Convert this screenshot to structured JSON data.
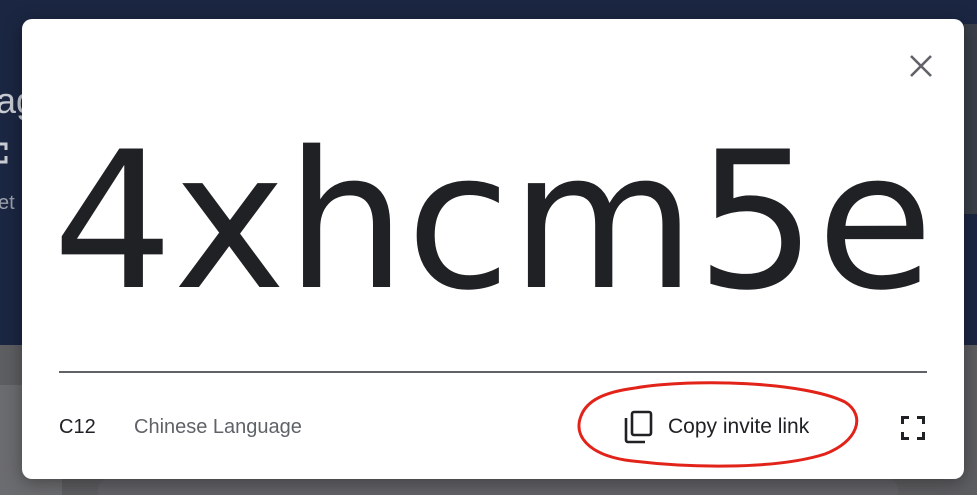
{
  "background": {
    "title_fragment": "ag",
    "subtitle_fragment": "et"
  },
  "modal": {
    "class_code": "4xhcm5e",
    "section": "C12",
    "class_name": "Chinese Language",
    "copy_link_label": "Copy invite link",
    "icons": {
      "close": "close-icon",
      "copy": "copy-icon",
      "fullscreen": "fullscreen-icon"
    },
    "annotation_color": "#e2231a"
  }
}
